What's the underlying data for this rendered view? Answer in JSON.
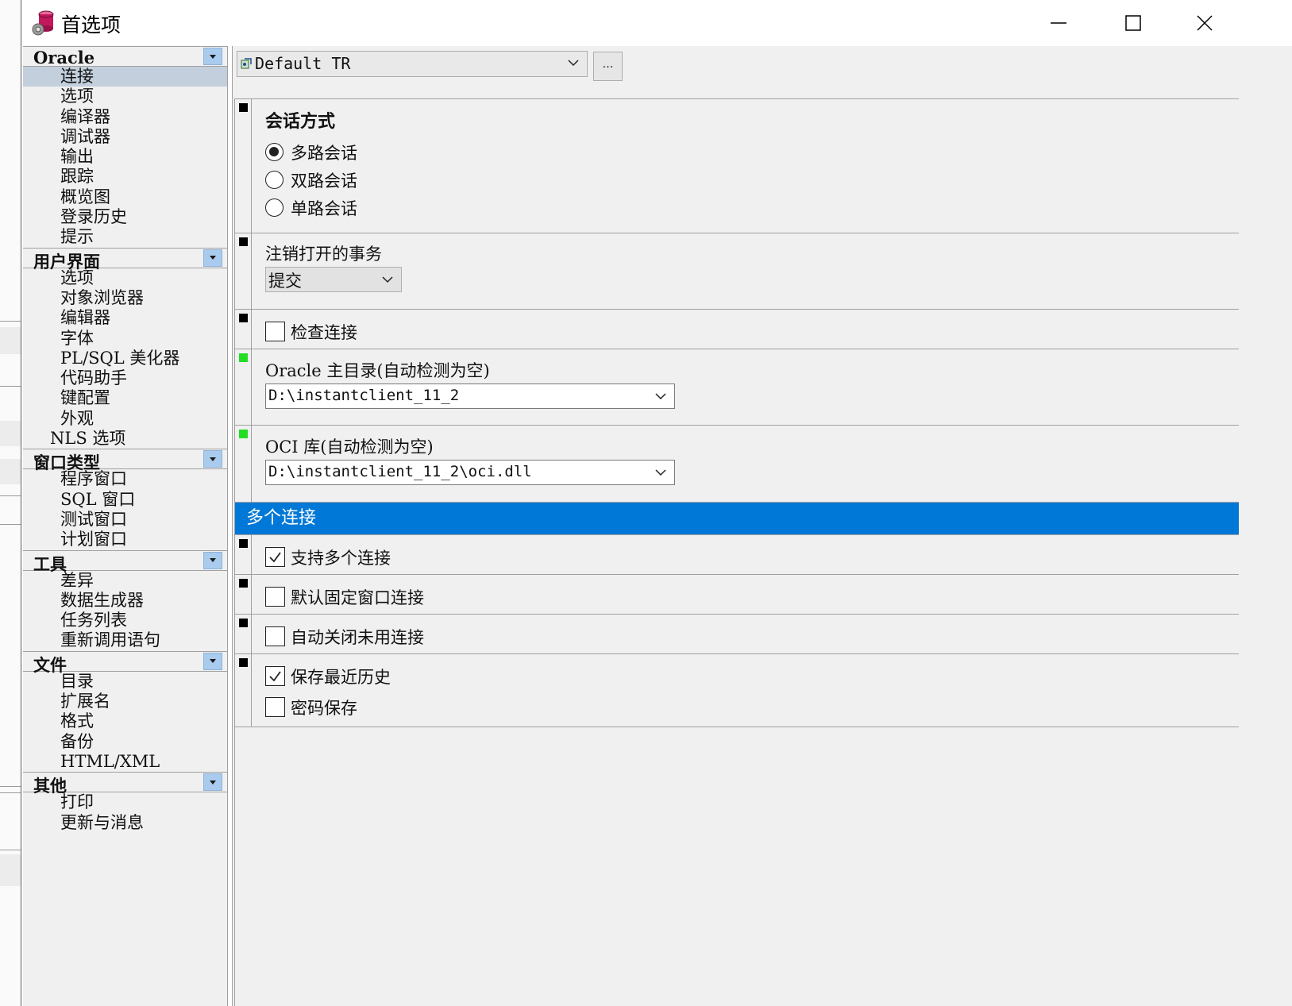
{
  "window": {
    "title": "首选项"
  },
  "nav": {
    "groups": [
      {
        "label": "Oracle",
        "items": [
          "连接",
          "选项",
          "编译器",
          "调试器",
          "输出",
          "跟踪",
          "概览图",
          "登录历史",
          "提示"
        ]
      },
      {
        "label": "用户界面",
        "items": [
          "选项",
          "对象浏览器",
          "编辑器",
          "字体",
          "PL/SQL 美化器",
          "代码助手",
          "键配置",
          "外观",
          "NLS 选项"
        ]
      },
      {
        "label": "窗口类型",
        "items": [
          "程序窗口",
          "SQL 窗口",
          "测试窗口",
          "计划窗口"
        ]
      },
      {
        "label": "工具",
        "items": [
          "差异",
          "数据生成器",
          "任务列表",
          "重新调用语句"
        ]
      },
      {
        "label": "文件",
        "items": [
          "目录",
          "扩展名",
          "格式",
          "备份",
          "HTML/XML"
        ]
      },
      {
        "label": "其他",
        "items": [
          "打印",
          "更新与消息"
        ]
      }
    ],
    "selected": "连接"
  },
  "profile": {
    "value": "Default TR",
    "browse_label": "…"
  },
  "session": {
    "title": "会话方式",
    "options": [
      "多路会话",
      "双路会话",
      "单路会话"
    ],
    "selected_index": 0
  },
  "logoff": {
    "label": "注销打开的事务",
    "value": "提交"
  },
  "check_connection": {
    "label": "检查连接",
    "checked": false
  },
  "oracle_home": {
    "label": "Oracle 主目录(自动检测为空)",
    "value": "D:\\instantclient_11_2"
  },
  "oci_library": {
    "label": "OCI 库(自动检测为空)",
    "value": "D:\\instantclient_11_2\\oci.dll"
  },
  "multi": {
    "header": "多个连接",
    "support_multiple": {
      "label": "支持多个连接",
      "checked": true
    },
    "default_fixed": {
      "label": "默认固定窗口连接",
      "checked": false
    },
    "auto_close": {
      "label": "自动关闭未用连接",
      "checked": false
    },
    "save_history": {
      "label": "保存最近历史",
      "checked": true
    },
    "save_password": {
      "label": "密码保存",
      "checked": false
    }
  },
  "colors": {
    "accent": "#0078d7",
    "selection": "#c3cfdc",
    "marker_green": "#22dd22",
    "group_button": "#a9cbee"
  }
}
